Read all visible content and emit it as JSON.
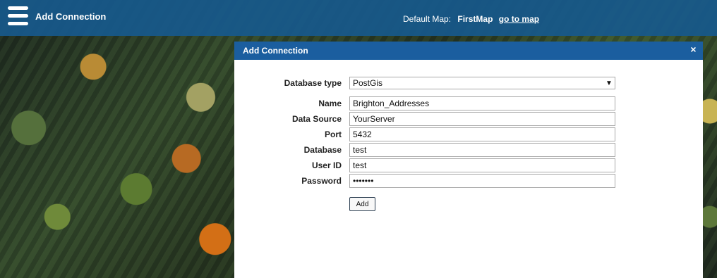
{
  "header": {
    "title": "Add Connection",
    "default_map_label": "Default Map:",
    "default_map_name": "FirstMap",
    "go_to_map_link": "go to map"
  },
  "dialog": {
    "title": "Add Connection",
    "close_icon": "×",
    "database_type": {
      "label": "Database type",
      "selected": "PostGis"
    },
    "name": {
      "label": "Name",
      "value": "Brighton_Addresses"
    },
    "data_source": {
      "label": "Data Source",
      "value": "YourServer"
    },
    "port": {
      "label": "Port",
      "value": "5432"
    },
    "database": {
      "label": "Database",
      "value": "test"
    },
    "user_id": {
      "label": "User ID",
      "value": "test"
    },
    "password": {
      "label": "Password",
      "value": "•••••••"
    },
    "add_button": "Add"
  },
  "colors": {
    "top_bar": "#17598c",
    "dialog_header": "#1b5e9f",
    "dialog_body": "#ffffff"
  },
  "icons": {
    "menu": "hamburger-menu-icon",
    "close": "close-icon",
    "dropdown": "chevron-down-icon"
  }
}
